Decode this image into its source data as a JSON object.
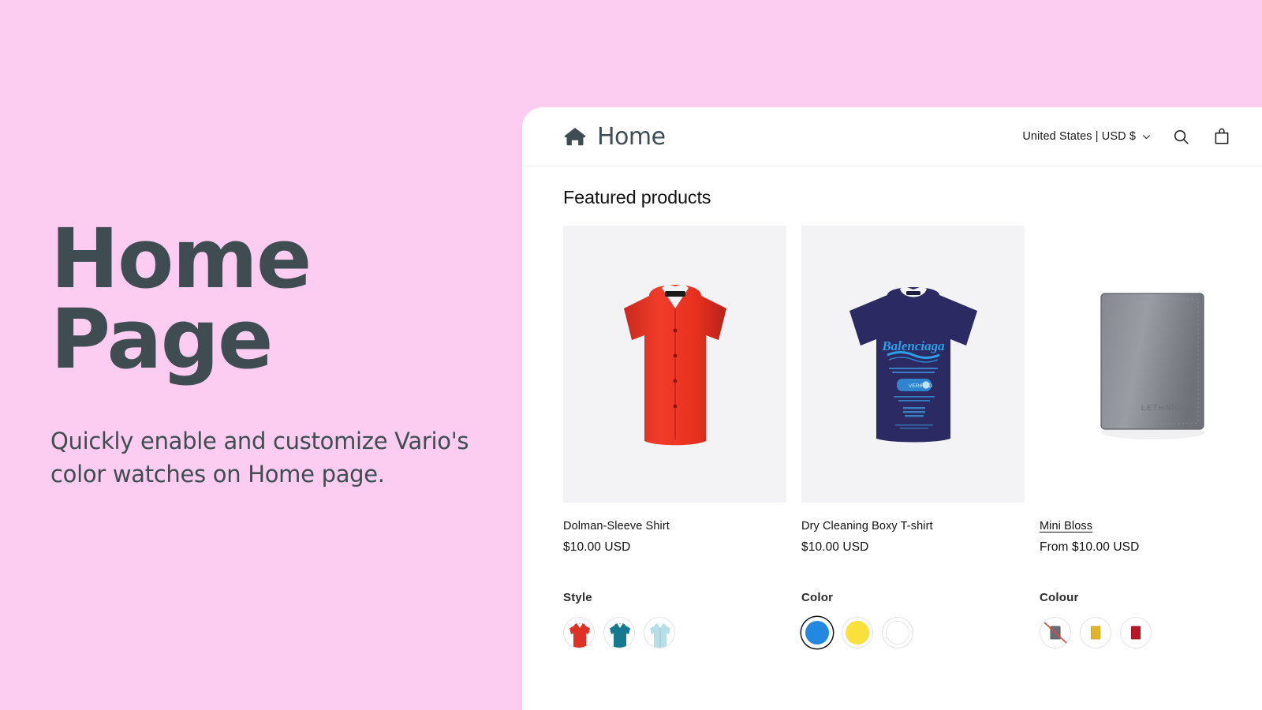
{
  "promo": {
    "title": "Home\nPage",
    "subtitle": "Quickly enable and customize Vario's color watches on Home page.",
    "background_color": "#fccdf0",
    "text_color": "#3f4d53"
  },
  "store": {
    "header": {
      "brand_name": "Home",
      "brand_icon": "home-icon",
      "locale": "United States | USD $",
      "locale_chevron_icon": "chevron-down-icon",
      "search_icon": "search-icon",
      "cart_icon": "shopping-bag-icon"
    },
    "section_title": "Featured products",
    "products": [
      {
        "title": "Dolman-Sleeve Shirt",
        "price": "$10.00 USD",
        "media_background": "#f3f3f5",
        "linked": false,
        "image_alt": "red-short-sleeve-button-shirt"
      },
      {
        "title": "Dry Cleaning Boxy T-shirt",
        "price": "$10.00 USD",
        "media_background": "#f3f3f5",
        "linked": false,
        "image_alt": "navy-graphic-tshirt"
      },
      {
        "title": "Mini Bloss",
        "price": "From $10.00 USD",
        "media_background": "#ffffff",
        "linked": true,
        "image_alt": "grey-leather-bifold-wallet"
      }
    ],
    "swatch_groups": [
      {
        "label": "Style",
        "type": "image",
        "options": [
          {
            "name": "red",
            "color": "#e03127",
            "selected": false,
            "sold_out": false
          },
          {
            "name": "teal",
            "color": "#17798f",
            "selected": false,
            "sold_out": false
          },
          {
            "name": "light-blue",
            "color": "#b6dee4",
            "selected": false,
            "sold_out": false
          }
        ]
      },
      {
        "label": "Color",
        "type": "color",
        "options": [
          {
            "name": "blue",
            "color": "#2389e0",
            "selected": true,
            "sold_out": false
          },
          {
            "name": "yellow",
            "color": "#f9e03c",
            "selected": false,
            "sold_out": false
          },
          {
            "name": "white",
            "color": "#ffffff",
            "selected": false,
            "sold_out": false
          }
        ]
      },
      {
        "label": "Colour",
        "type": "image",
        "options": [
          {
            "name": "grey",
            "color": "#6a6d74",
            "selected": false,
            "sold_out": true
          },
          {
            "name": "yellow",
            "color": "#e0b528",
            "selected": false,
            "sold_out": false
          },
          {
            "name": "red",
            "color": "#ba1426",
            "selected": false,
            "sold_out": false
          }
        ]
      }
    ]
  }
}
